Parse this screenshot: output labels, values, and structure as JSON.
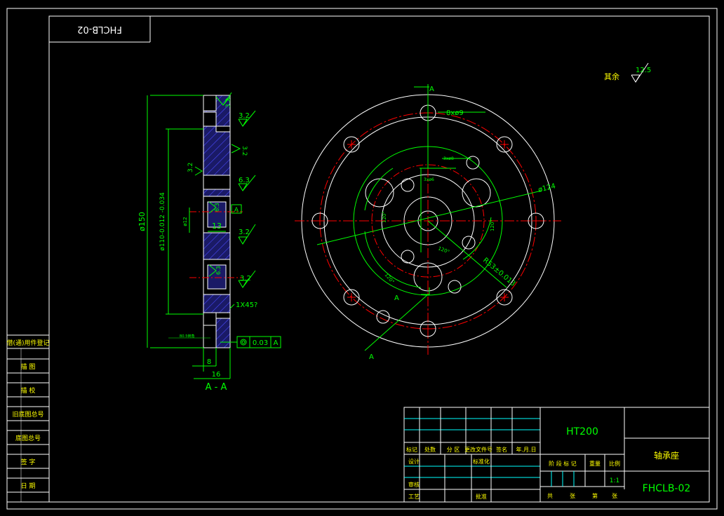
{
  "drawing": {
    "code_mirrored": "FHCLB-02",
    "code": "FHCLB-02",
    "material": "HT200",
    "part_name": "轴承座",
    "scale": "1:1",
    "roughness_rest_label": "其余",
    "roughness_rest_value": "12.5",
    "colors": {
      "frame": "#ffffff",
      "dimension": "#00ff00",
      "section_line": "#ff0000",
      "text_yellow": "#ffff00",
      "hatch": "#3a3aff",
      "cyan": "#00ffff"
    }
  },
  "left_view": {
    "dims": {
      "overall_dia": "ø150",
      "inner_dia": "ø110-0.012 -0.034",
      "small_dia": "ø12",
      "width_8": "8",
      "width_16": "16",
      "depth_13": "13",
      "chamfer": "1X45?",
      "runout": "0.03",
      "runout_datum": "A",
      "datum_flag": "A",
      "note_small": "B0.5倒角"
    },
    "roughness": [
      "3.2",
      "3.2",
      "3.2",
      "3.2",
      "6.3",
      "6.3",
      "3.2",
      "6.3",
      "3.2"
    ],
    "section_label": "A - A"
  },
  "right_view": {
    "holes_label": "8xø9",
    "dia_124": "ø124",
    "radius": "R53±0.013",
    "small_label_1": "3xø8",
    "small_label_2": "3xø6",
    "angle_120_a": "120°",
    "angle_120_b": "120°",
    "angle_120_c": "120°",
    "angle_120_d": "120°",
    "section_mark": "A"
  },
  "side_table": {
    "rows": [
      "借(通)用件登记",
      "描 图",
      "描 校",
      "旧底图总号",
      "底图总号",
      "签 字",
      "日 期"
    ]
  },
  "title_block": {
    "row_headers": [
      "标记",
      "处数",
      "分 区",
      "更改文件号",
      "签名",
      "年.月.日"
    ],
    "left_labels": [
      "设计",
      "标准化",
      "审核",
      "工艺",
      "批准"
    ],
    "stage_header": [
      "阶 段 标 记",
      "重量",
      "比例"
    ],
    "footer": [
      "共",
      "张",
      "第",
      "张"
    ]
  }
}
